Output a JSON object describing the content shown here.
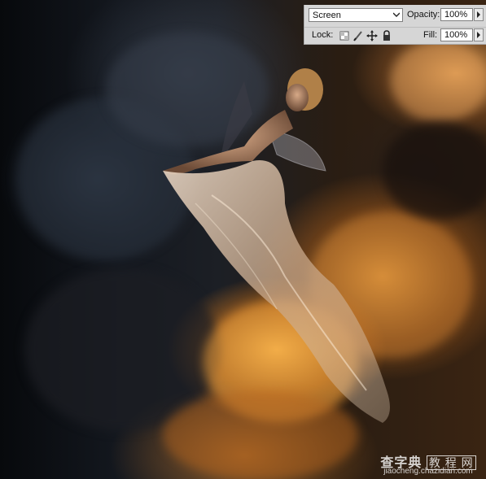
{
  "layers_panel": {
    "blend_mode": "Screen",
    "opacity_label": "Opacity:",
    "opacity_value": "100%",
    "lock_label": "Lock:",
    "fill_label": "Fill:",
    "fill_value": "100%",
    "lock_icons": [
      "lock-transparent-pixels-icon",
      "lock-image-pixels-icon",
      "lock-position-icon",
      "lock-all-icon"
    ]
  },
  "watermark": {
    "brand_text": "查字典",
    "brand_boxed": "教 程 网",
    "url": "jiaocheng.chazidian.com"
  },
  "colors": {
    "panel_bg": "#d6d6d6",
    "cloud_glow": "#f0a845",
    "sky_dark": "#0d0f13"
  }
}
